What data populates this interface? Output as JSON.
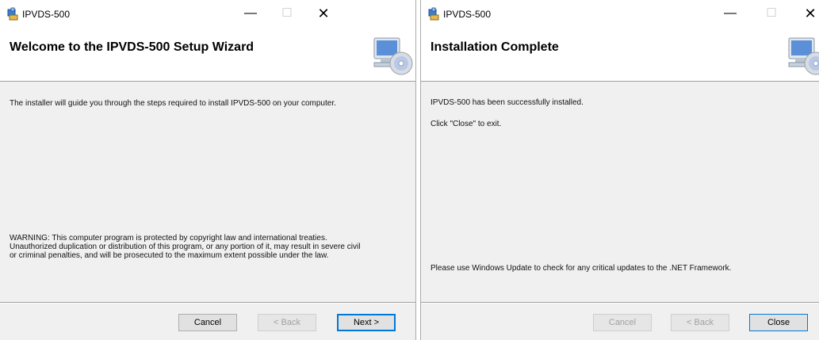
{
  "window1": {
    "title": "IPVDS-500",
    "banner_title": "Welcome to the IPVDS-500 Setup Wizard",
    "intro": "The installer will guide you through the steps required to install IPVDS-500 on your computer.",
    "warning_lines": [
      "WARNING: This computer program is protected by copyright law and international treaties.",
      "Unauthorized duplication or distribution of this program, or any portion of it, may result in severe civil",
      "or criminal penalties, and will be prosecuted to the maximum extent possible under the law."
    ],
    "buttons": {
      "cancel": "Cancel",
      "back": "< Back",
      "next": "Next >"
    }
  },
  "window2": {
    "title": "IPVDS-500",
    "banner_title": "Installation Complete",
    "success": "IPVDS-500 has been successfully installed.",
    "click_close": "Click \"Close\" to exit.",
    "update_note": "Please use Windows Update to check for any critical updates to the .NET Framework.",
    "buttons": {
      "cancel": "Cancel",
      "back": "< Back",
      "close": "Close"
    }
  },
  "controls": {
    "minimize": "—",
    "maximize": "☐",
    "close": "✕"
  },
  "icons": [
    "installer-app-icon",
    "computer-cd-icon",
    "minimize-icon",
    "maximize-icon",
    "close-icon"
  ],
  "colors": {
    "default_button_border": "#0078d7",
    "dialog_bg": "#f0f0f0",
    "banner_bg": "#ffffff"
  }
}
